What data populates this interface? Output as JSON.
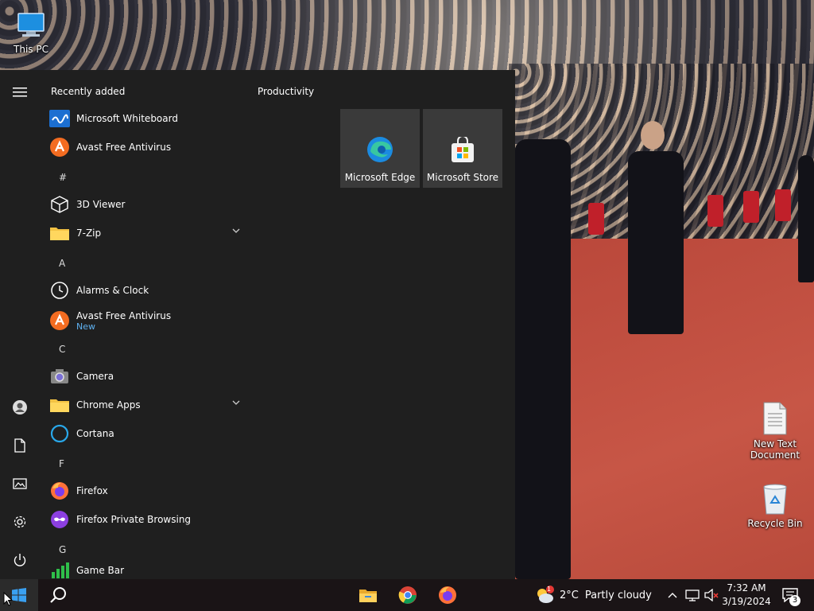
{
  "desktop": {
    "icons": [
      {
        "label": "This PC",
        "icon": "computer-icon"
      },
      {
        "label": "New Text Document",
        "icon": "text-document-icon"
      },
      {
        "label": "Recycle Bin",
        "icon": "recycle-bin-icon"
      }
    ]
  },
  "start_menu": {
    "rail": [
      "hamburger-menu-icon",
      "user-account-icon",
      "documents-icon",
      "pictures-icon",
      "settings-icon",
      "power-icon"
    ],
    "list_header": "Recently added",
    "recent": [
      {
        "name": "Microsoft Whiteboard"
      },
      {
        "name": "Avast Free Antivirus"
      }
    ],
    "letters": {
      "hash": "#",
      "a": "A",
      "c": "C",
      "f": "F",
      "g": "G"
    },
    "apps": {
      "viewer3d": "3D Viewer",
      "zip7": "7-Zip",
      "alarms": "Alarms & Clock",
      "avast": "Avast Free Antivirus",
      "avast_sub": "New",
      "camera": "Camera",
      "chrome_apps": "Chrome Apps",
      "cortana": "Cortana",
      "firefox": "Firefox",
      "firefox_private": "Firefox Private Browsing",
      "game_bar": "Game Bar"
    },
    "group_title": "Productivity",
    "tiles": [
      {
        "label": "Microsoft Edge"
      },
      {
        "label": "Microsoft Store"
      }
    ]
  },
  "taskbar": {
    "pinned": [
      "file-explorer-icon",
      "chrome-icon",
      "firefox-icon"
    ],
    "weather": {
      "temp": "2°C",
      "condition": "Partly cloudy",
      "alert_count": "1"
    },
    "clock": {
      "time": "7:32 AM",
      "date": "3/19/2024"
    },
    "notifications": "3"
  },
  "colors": {
    "start_bg": "#1f1f1f",
    "tile_bg": "#3a3a3a",
    "accent_blue": "#0078d7",
    "sub_text": "#5fb2f2"
  }
}
